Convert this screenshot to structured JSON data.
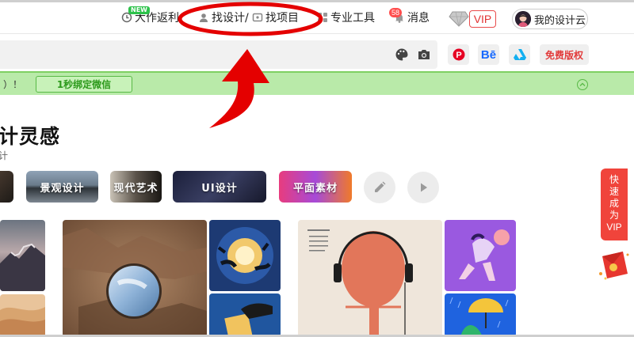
{
  "nav": {
    "rebate": "大作返利",
    "rebate_badge": "NEW",
    "find_design": "找设计/",
    "find_project": "找项目",
    "pro_tools": "专业工具",
    "messages": "消息",
    "messages_count": "58",
    "vip": "VIP",
    "my_cloud": "我的设计云"
  },
  "search": {
    "palette_icon": "palette-icon",
    "camera_icon": "camera-icon"
  },
  "social": {
    "pinterest": "P",
    "behance": "Bē",
    "artstation": "artstation-icon",
    "copyright": "免费版权"
  },
  "notice": {
    "text": "）！",
    "bind_button": "1秒绑定微信"
  },
  "heading": {
    "title": "计灵感",
    "subtitle": "计"
  },
  "categories": [
    {
      "label": ""
    },
    {
      "label": "景观设计"
    },
    {
      "label": "现代艺术"
    },
    {
      "label": "UI设计"
    },
    {
      "label": "平面素材"
    }
  ],
  "float": {
    "vip_text": [
      "快",
      "速",
      "成",
      "为",
      "VIP"
    ]
  },
  "colors": {
    "accent_red": "#e23232",
    "notice_green": "#b9eaa9",
    "float_red": "#f0443b"
  }
}
